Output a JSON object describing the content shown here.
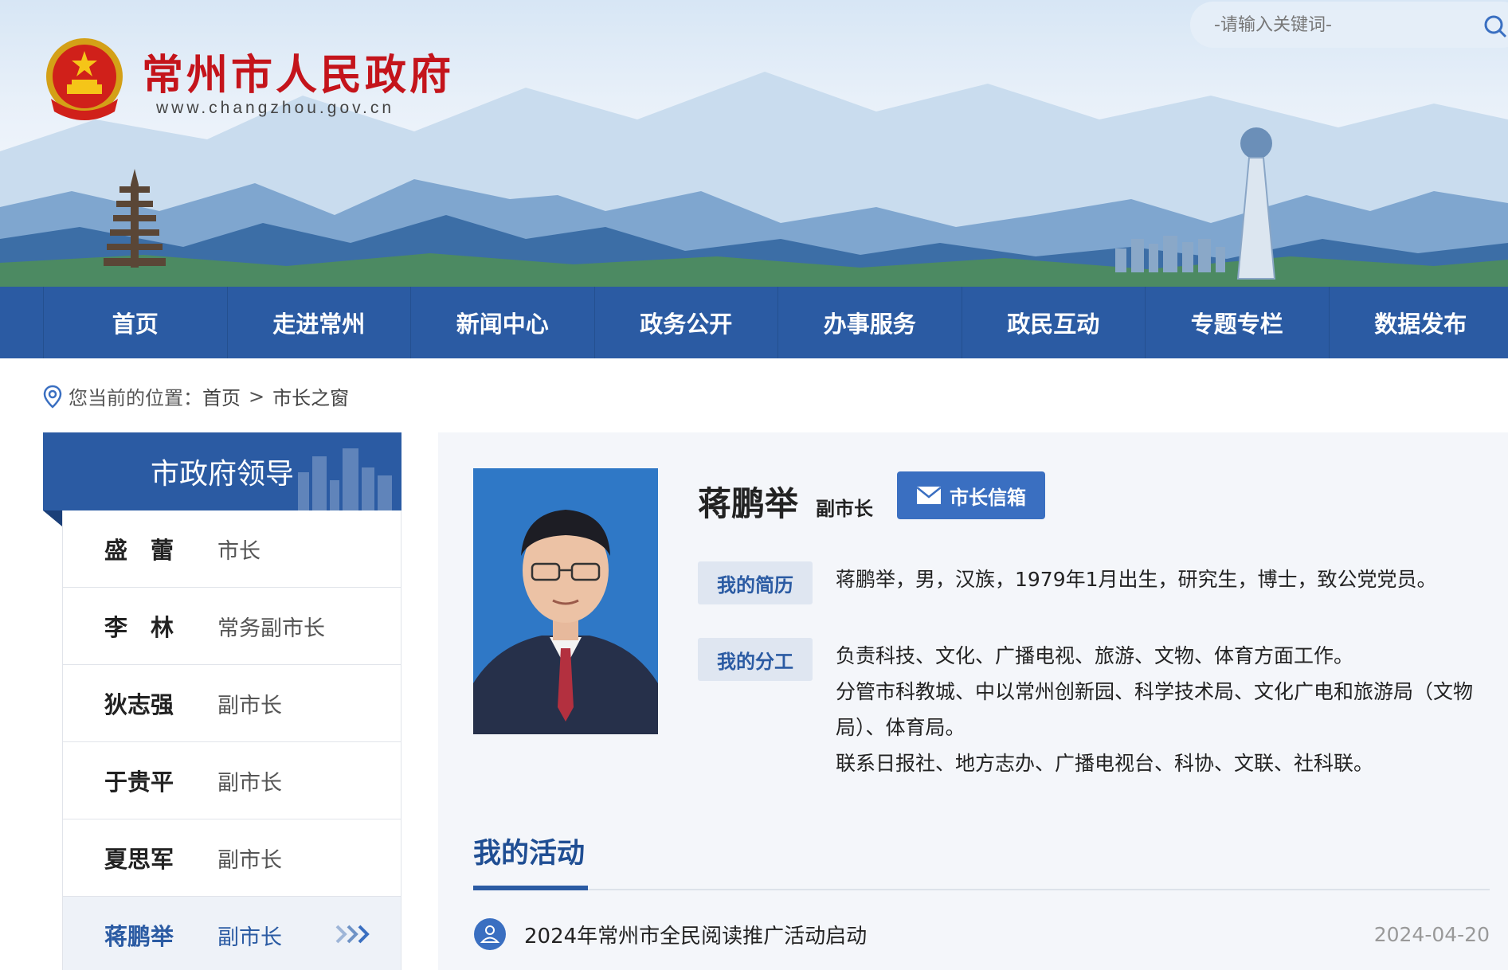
{
  "header": {
    "site_title": "常州市人民政府",
    "site_url": "www.changzhou.gov.cn",
    "search_placeholder": "-请输入关键词-",
    "emblem_icon": "national-emblem",
    "search_icon": "search-icon"
  },
  "nav": {
    "items": [
      "首页",
      "走进常州",
      "新闻中心",
      "政务公开",
      "办事服务",
      "政民互动",
      "专题专栏",
      "数据发布"
    ]
  },
  "breadcrumb": {
    "prefix": "您当前的位置：",
    "home": "首页",
    "separator": ">",
    "current": "市长之窗"
  },
  "sidebar": {
    "title": "市政府领导",
    "leaders": [
      {
        "name": "盛　蕾",
        "role": "市长"
      },
      {
        "name": "李　林",
        "role": "常务副市长"
      },
      {
        "name": "狄志强",
        "role": "副市长"
      },
      {
        "name": "于贵平",
        "role": "副市长"
      },
      {
        "name": "夏思军",
        "role": "副市长"
      },
      {
        "name": "蒋鹏举",
        "role": "副市长"
      }
    ],
    "active_index": 5
  },
  "profile": {
    "name": "蒋鹏举",
    "title": "副市长",
    "mailbox_label": "市长信箱",
    "bio_tag": "我的简历",
    "bio_text": "蒋鹏举，男，汉族，1979年1月出生，研究生，博士，致公党党员。",
    "duty_tag": "我的分工",
    "duty_line1": "负责科技、文化、广播电视、旅游、文物、体育方面工作。",
    "duty_line2": "分管市科教城、中以常州创新园、科学技术局、文化广电和旅游局（文物局）、体育局。",
    "duty_line3": "联系日报社、地方志办、广播电视台、科协、文联、社科联。"
  },
  "activities": {
    "title": "我的活动",
    "items": [
      {
        "text": "2024年常州市全民阅读推广活动启动",
        "date": "2024-04-20"
      }
    ]
  },
  "colors": {
    "nav_blue": "#2b5ba3",
    "title_red": "#c4141b",
    "button_blue": "#3a6fc1"
  }
}
